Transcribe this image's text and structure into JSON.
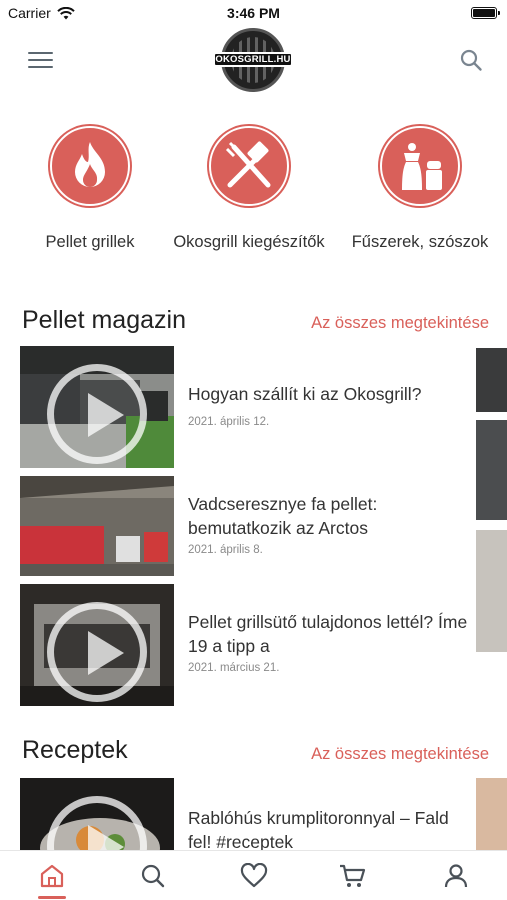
{
  "status": {
    "carrier": "Carrier",
    "time": "3:46 PM"
  },
  "header": {
    "logo_text": "OKOSGRILL.HU"
  },
  "categories": [
    {
      "label": "Pellet grillek",
      "icon": "flame-icon"
    },
    {
      "label": "Okosgrill kiegészítők",
      "icon": "grill-tools-icon"
    },
    {
      "label": "Fűszerek, szószok",
      "icon": "salt-pepper-icon"
    }
  ],
  "magazine": {
    "title": "Pellet magazin",
    "see_all": "Az összes megtekintése",
    "items": [
      {
        "title": "Hogyan szállít ki az Okosgrill?",
        "date": "2021. április 12.",
        "video": true
      },
      {
        "title": "Vadcseresznye fa pellet: bemutatkozik az Arctos",
        "date": "2021. április 8.",
        "video": false
      },
      {
        "title": "Pellet grillsütő tulajdonos lettél? Íme 19 a tipp a",
        "date": "2021. március 21.",
        "video": true
      }
    ]
  },
  "recipes": {
    "title": "Receptek",
    "see_all": "Az összes megtekintése",
    "items": [
      {
        "title": "Rablóhús krumplitoronnyal – Fald fel! #receptek",
        "video": true
      }
    ]
  },
  "tabs": [
    {
      "name": "home",
      "icon": "home-icon",
      "active": true
    },
    {
      "name": "search",
      "icon": "search-icon"
    },
    {
      "name": "favorites",
      "icon": "heart-icon"
    },
    {
      "name": "cart",
      "icon": "cart-icon"
    },
    {
      "name": "account",
      "icon": "user-icon"
    }
  ],
  "colors": {
    "accent": "#d9605a",
    "text": "#333333",
    "muted": "#8a8a8a"
  }
}
